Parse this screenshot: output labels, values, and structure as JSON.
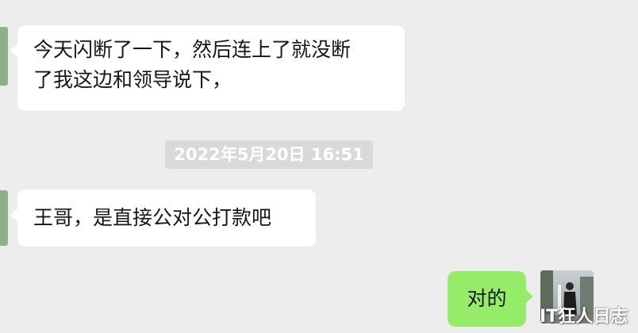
{
  "messages": [
    {
      "side": "left",
      "text": "今天闪断了一下，然后连上了就没断\n了我这边和领导说下，"
    },
    {
      "side": "left",
      "text": "王哥，是直接公对公打款吧"
    },
    {
      "side": "right",
      "text": "对的"
    }
  ],
  "timestamp": "2022年5月20日 16:51",
  "watermark": "IT狂人日志",
  "colors": {
    "background": "#ededed",
    "received_bubble": "#ffffff",
    "sent_bubble": "#95ec69",
    "timestamp_bg": "#d9d9d9"
  }
}
